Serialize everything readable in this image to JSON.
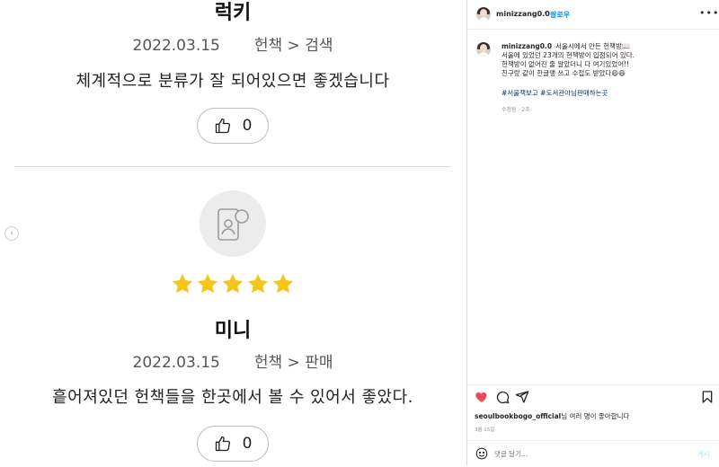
{
  "reviews": [
    {
      "name": "럭키",
      "date": "2022.03.15",
      "category": "헌책 > 검색",
      "body": "체계적으로 분류가 잘 되어있으면 좋겠습니다",
      "likes": "0"
    },
    {
      "name": "미니",
      "date": "2022.03.15",
      "category": "헌책 > 판매",
      "body": "흩어져있던 헌책들을 한곳에서 볼 수 있어서 좋았다.",
      "likes": "0",
      "rating": 5,
      "rating_max": 5
    }
  ],
  "instagram": {
    "username": "minizzang0.0",
    "separator": "•",
    "follow_label": "팔로우",
    "caption_lines": [
      "서울시에서 만든 헌책방📖",
      "서울에 있었던 23개의 헌책방이 입점되어 있다.",
      "헌책방이 없어진 줄 알았더니 다 여기있었어!!",
      "친구랑 같이 한글맹 쓰고 수첩도 받았다😄😄"
    ],
    "hashtags": "#서울책보고 #도서관아님판매하는곳",
    "edited_text": "수정됨 · 2주",
    "likes_user": "seoulbookbogo_official",
    "likes_suffix": "님 여러 명이 좋아합니다",
    "post_date": "3월 15일",
    "comment_placeholder": "댓글 달기...",
    "post_label": "게시",
    "heart_color": "#ed4956",
    "link_color": "#0095f6"
  },
  "colors": {
    "star": "#f5c518",
    "divider": "#d6d6d6"
  }
}
